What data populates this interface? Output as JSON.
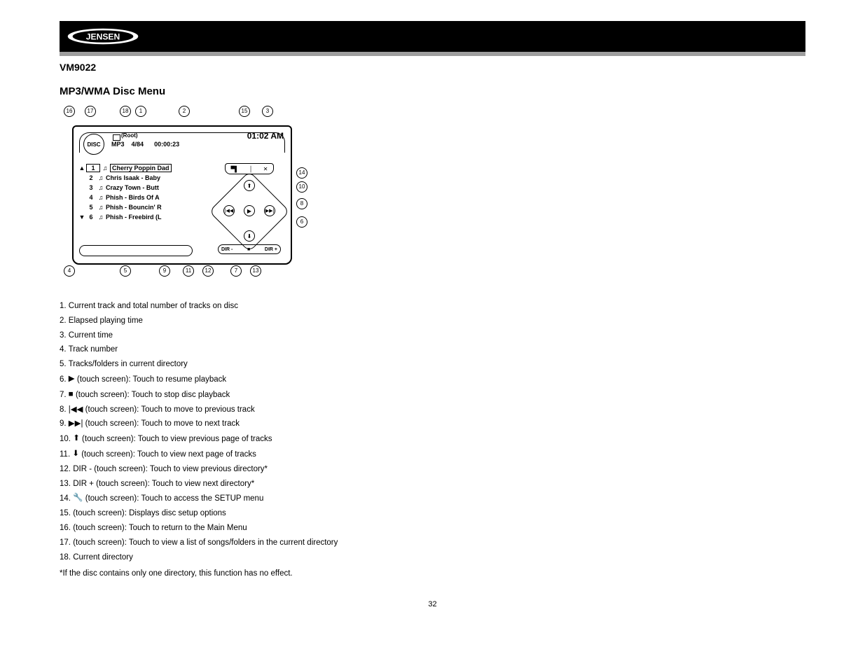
{
  "header": {
    "brand": "JENSEN",
    "model": "VM9022"
  },
  "section_title": "MP3/WMA Disc Menu",
  "diagram": {
    "callouts_top": [
      "16",
      "17",
      "18",
      "1",
      "2",
      "15",
      "3"
    ],
    "callouts_right": [
      "14",
      "10",
      "8",
      "6"
    ],
    "callouts_bottom": [
      "4",
      "5",
      "9",
      "11",
      "12",
      "7",
      "13"
    ],
    "disc_label": "DISC",
    "root_label": "(Root)",
    "format_line": {
      "format": "MP3",
      "counter": "4/84",
      "elapsed": "00:00:23"
    },
    "clock": "01:02 AM",
    "tracks": [
      {
        "n": "1",
        "title": "Cherry Poppin Dad"
      },
      {
        "n": "2",
        "title": "Chris Isaak - Baby"
      },
      {
        "n": "3",
        "title": "Crazy Town - Butt"
      },
      {
        "n": "4",
        "title": "Phish - Birds Of A"
      },
      {
        "n": "5",
        "title": "Phish - Bouncin' R"
      },
      {
        "n": "6",
        "title": "Phish - Freebird (L"
      }
    ],
    "navpad": {
      "prev": "|◀◀",
      "play": "▶",
      "next": "▶▶|",
      "up": "⬆",
      "down": "⬇",
      "dir_minus": "DIR -",
      "stop": "■",
      "dir_plus": "DIR +",
      "tool_left": "▀▌",
      "tool_mid": "│",
      "tool_right": "✕"
    }
  },
  "defs": [
    {
      "n": "1.",
      "text": "Current track and total number of tracks on disc"
    },
    {
      "n": "2.",
      "text": "Elapsed playing time"
    },
    {
      "n": "3.",
      "text": "Current time"
    },
    {
      "n": "4.",
      "text": "Track number"
    },
    {
      "n": "5.",
      "text": "Tracks/folders in current directory"
    },
    {
      "n": "6.",
      "text": "(touch screen): Touch to resume playback"
    },
    {
      "n": "7.",
      "text": "(touch screen): Touch to stop disc playback"
    },
    {
      "n": "8.",
      "text": "|◀◀ (touch screen): Touch to move to previous track"
    },
    {
      "n": "9.",
      "text": "▶▶| (touch screen): Touch to move to next track"
    },
    {
      "n": "10.",
      "text": "(touch screen): Touch to view previous page of tracks"
    },
    {
      "n": "11.",
      "text": "(touch screen): Touch to view next page of tracks"
    },
    {
      "n": "12.",
      "text": "DIR - (touch screen): Touch to view previous directory*"
    },
    {
      "n": "13.",
      "text": "DIR + (touch screen): Touch to view next directory*"
    },
    {
      "n": "14.",
      "text": "(touch screen): Touch to access the SETUP menu"
    },
    {
      "n": "15.",
      "text": "(touch screen): Displays disc setup options"
    },
    {
      "n": "16.",
      "text": "(touch screen): Touch to return to the Main Menu"
    },
    {
      "n": "17.",
      "text": "(touch screen): Touch to view a list of songs/folders in the current directory"
    },
    {
      "n": "18.",
      "text": "Current directory"
    }
  ],
  "footnote": "*If the disc contains only one directory, this function has no effect.",
  "page_number": "32"
}
